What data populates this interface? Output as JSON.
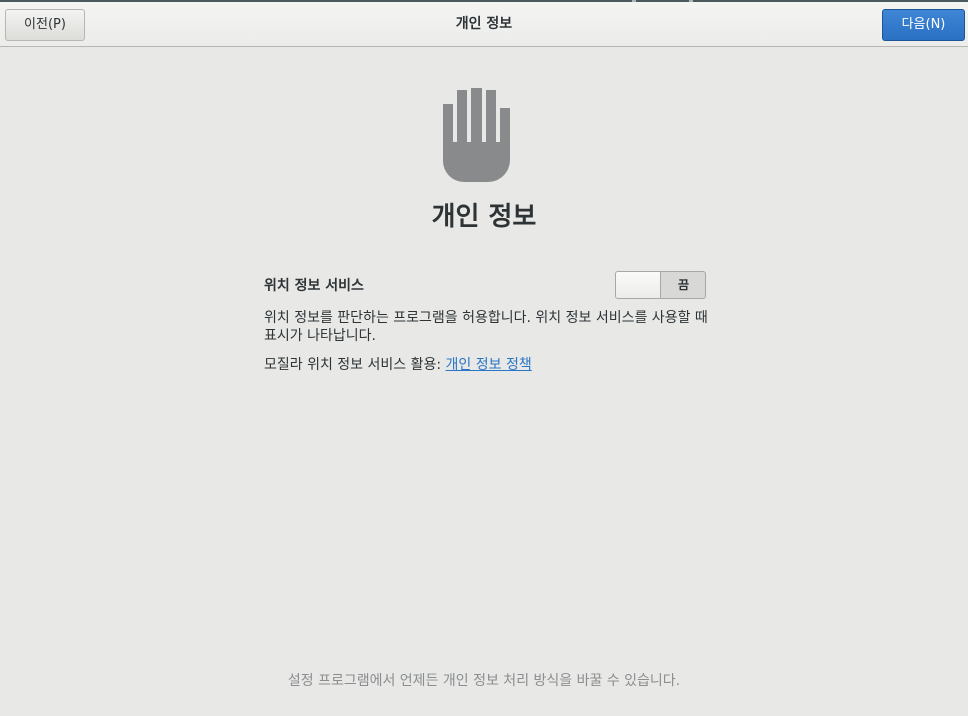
{
  "header": {
    "title": "개인 정보",
    "prev_label": "이전(P)",
    "next_label": "다음(N)"
  },
  "main": {
    "icon": "privacy-hand-icon",
    "title": "개인 정보",
    "location": {
      "label": "위치 정보 서비스",
      "switch_state": "끔",
      "description": "위치 정보를 판단하는 프로그램을 허용합니다. 위치 정보 서비스를 사용할 때 표시가 나타납니다.",
      "mozilla_prefix": "모질라 위치 정보 서비스 활용:",
      "policy_link": "개인 정보 정책"
    }
  },
  "footer": {
    "text": "설정 프로그램에서 언제든 개인 정보 처리 방식을 바꿀 수 있습니다."
  },
  "colors": {
    "accent": "#2a76c6",
    "next_button": "#3584e4",
    "icon": "#888a8b",
    "background": "#e8e8e7"
  }
}
